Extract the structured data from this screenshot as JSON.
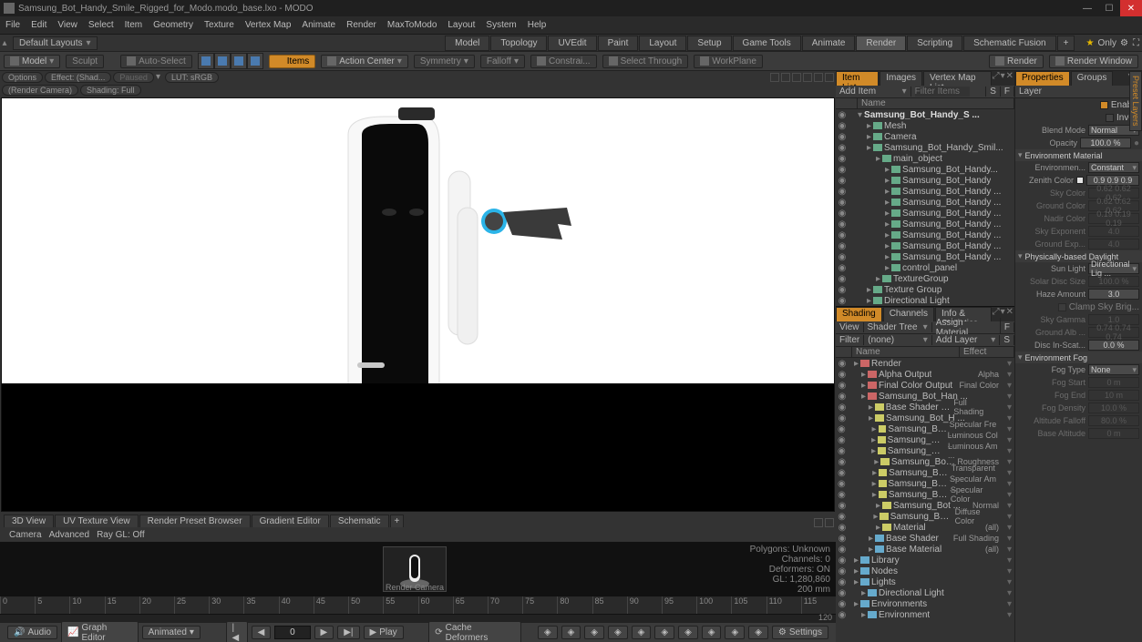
{
  "title": "Samsung_Bot_Handy_Smile_Rigged_for_Modo.modo_base.lxo - MODO",
  "menus": [
    "File",
    "Edit",
    "View",
    "Select",
    "Item",
    "Geometry",
    "Texture",
    "Vertex Map",
    "Animate",
    "Render",
    "MaxToModo",
    "Layout",
    "System",
    "Help"
  ],
  "layout_dropdown": "Default Layouts",
  "layout_tabs": [
    "Model",
    "Topology",
    "UVEdit",
    "Paint",
    "Layout",
    "Setup",
    "Game Tools",
    "Animate",
    "Render",
    "Scripting",
    "Schematic Fusion"
  ],
  "layout_active": "Render",
  "only_label": "Only",
  "toolbar": {
    "model": "Model",
    "sculpt": "Sculpt",
    "auto_select": "Auto-Select",
    "items": "Items",
    "action_center": "Action Center",
    "symmetry": "Symmetry",
    "falloff": "Falloff",
    "constrain": "Constrai...",
    "select_through": "Select Through",
    "workplane": "WorkPlane",
    "render": "Render",
    "render_window": "Render Window"
  },
  "viewport_chips": {
    "options": "Options",
    "effect": "Effect: (Shad...",
    "paused": "Paused",
    "lut": "LUT: sRGB",
    "render_cam": "(Render Camera)",
    "shading": "Shading: Full"
  },
  "viewport_tabs": [
    "3D View",
    "UV Texture View",
    "Render Preset Browser",
    "Gradient Editor",
    "Schematic"
  ],
  "camera_row": {
    "camera": "Camera",
    "advanced": "Advanced",
    "ray_gl": "Ray GL: Off"
  },
  "thumb_label": "Render Camera",
  "stats": {
    "l1": "Polygons: Unknown",
    "l2": "Channels: 0",
    "l3": "Deformers: ON",
    "l4": "GL: 1,280,860",
    "l5": "200 mm"
  },
  "timeline_start": "0",
  "timeline_end": "120",
  "timeline_extra": "120",
  "transport": {
    "audio": "Audio",
    "graph": "Graph Editor",
    "animated": "Animated",
    "frame": "0",
    "play": "Play",
    "cache": "Cache Deformers",
    "settings": "Settings"
  },
  "item_panel": {
    "tabs": [
      "Item List",
      "Images",
      "Vertex Map List"
    ],
    "tabs_active": "Item List",
    "add_item": "Add Item",
    "filter_items": "Filter Items",
    "s": "S",
    "f": "F",
    "header": "Name",
    "root": "Samsung_Bot_Handy_S ...",
    "tree": [
      "Mesh",
      "Camera",
      "Samsung_Bot_Handy_Smil...",
      "main_object",
      "Samsung_Bot_Handy...",
      "Samsung_Bot_Handy",
      "Samsung_Bot_Handy ...",
      "Samsung_Bot_Handy ...",
      "Samsung_Bot_Handy ...",
      "Samsung_Bot_Handy ...",
      "Samsung_Bot_Handy ...",
      "Samsung_Bot_Handy ...",
      "Samsung_Bot_Handy ...",
      "control_panel",
      "TextureGroup",
      "Texture Group",
      "Directional Light"
    ]
  },
  "shader_panel": {
    "tabs": [
      "Shading",
      "Channels",
      "Info & Statistics"
    ],
    "tabs_active": "Shading",
    "view": "View",
    "shader_tree": "Shader Tree",
    "assign": "Assign Material",
    "f": "F",
    "filter": "Filter",
    "none": "(none)",
    "add_layer": "Add Layer",
    "s": "S",
    "header_name": "Name",
    "header_effect": "Effect",
    "rows": [
      {
        "n": "Render",
        "e": ""
      },
      {
        "n": "Alpha Output",
        "e": "Alpha"
      },
      {
        "n": "Final Color Output",
        "e": "Final Color"
      },
      {
        "n": "Samsung_Bot_Han ...",
        "e": ""
      },
      {
        "n": "Base Shader (2)",
        "e": "Full Shading"
      },
      {
        "n": "Samsung_Bot_H ...",
        "e": ""
      },
      {
        "n": "Samsung_Bot ...",
        "e": "Specular Fre ..."
      },
      {
        "n": "Samsung_Bot ...",
        "e": "Luminous Col ..."
      },
      {
        "n": "Samsung_Bot ...",
        "e": "Luminous Am ..."
      },
      {
        "n": "Samsung_Bot ...",
        "e": "Roughness"
      },
      {
        "n": "Samsung_Bot ...",
        "e": "Transparent ..."
      },
      {
        "n": "Samsung_Bot ...",
        "e": "Specular Am ..."
      },
      {
        "n": "Samsung_Bot ...",
        "e": "Specular Color"
      },
      {
        "n": "Samsung_Bot ...",
        "e": "Normal"
      },
      {
        "n": "Samsung_Bot ...",
        "e": "Diffuse Color"
      },
      {
        "n": "Material",
        "e": "(all)"
      },
      {
        "n": "Base Shader",
        "e": "Full Shading"
      },
      {
        "n": "Base Material",
        "e": "(all)"
      },
      {
        "n": "Library",
        "e": ""
      },
      {
        "n": "Nodes",
        "e": ""
      },
      {
        "n": "Lights",
        "e": ""
      },
      {
        "n": "Directional Light",
        "e": ""
      },
      {
        "n": "Environments",
        "e": ""
      },
      {
        "n": "Environment",
        "e": ""
      }
    ]
  },
  "props": {
    "tabs": [
      "Properties",
      "Groups"
    ],
    "tabs_active": "Properties",
    "layer": "Layer",
    "enable": "Enable",
    "invert": "Invert",
    "blend_mode": "Blend Mode",
    "blend_mode_v": "Normal",
    "opacity": "Opacity",
    "opacity_v": "100.0 %",
    "env_mat": "Environment Material",
    "env_type": "Environmen...",
    "env_type_v": "Constant",
    "zenith": "Zenith Color",
    "zenith_v": "0.9   0.9   0.9",
    "sky": "Sky Color",
    "sky_v": "0.62 0.62 0.62",
    "ground": "Ground Color",
    "ground_v": "0.62 0.62 0.62",
    "nadir": "Nadir Color",
    "nadir_v": "0.19 0.19 0.19",
    "sky_exp": "Sky Exponent",
    "sky_exp_v": "4.0",
    "ground_exp": "Ground Exp...",
    "ground_exp_v": "4.0",
    "pbd": "Physically-based Daylight",
    "sun_light": "Sun Light",
    "sun_light_v": "Directional Lig ...",
    "solar_disc": "Solar Disc Size",
    "solar_disc_v": "100.0 %",
    "haze": "Haze Amount",
    "haze_v": "3.0",
    "clamp_sky": "Clamp Sky Brig...",
    "sky_gamma": "Sky Gamma",
    "sky_gamma_v": "1.0",
    "ground_alb": "Ground Alb ...",
    "ground_alb_v": "0.74 0.74 0.74",
    "disc_in": "Disc In-Scat...",
    "disc_in_v": "0.0 %",
    "env_fog": "Environment Fog",
    "fog_type": "Fog Type",
    "fog_type_v": "None",
    "fog_start": "Fog Start",
    "fog_start_v": "0 m",
    "fog_end": "Fog End",
    "fog_end_v": "10 m",
    "fog_density": "Fog Density",
    "fog_density_v": "10.0 %",
    "alt_falloff": "Altitude Falloff",
    "alt_falloff_v": "80.0 %",
    "base_alt": "Base Altitude",
    "base_alt_v": "0 m"
  },
  "right_tabs_label": "Preset Layers"
}
